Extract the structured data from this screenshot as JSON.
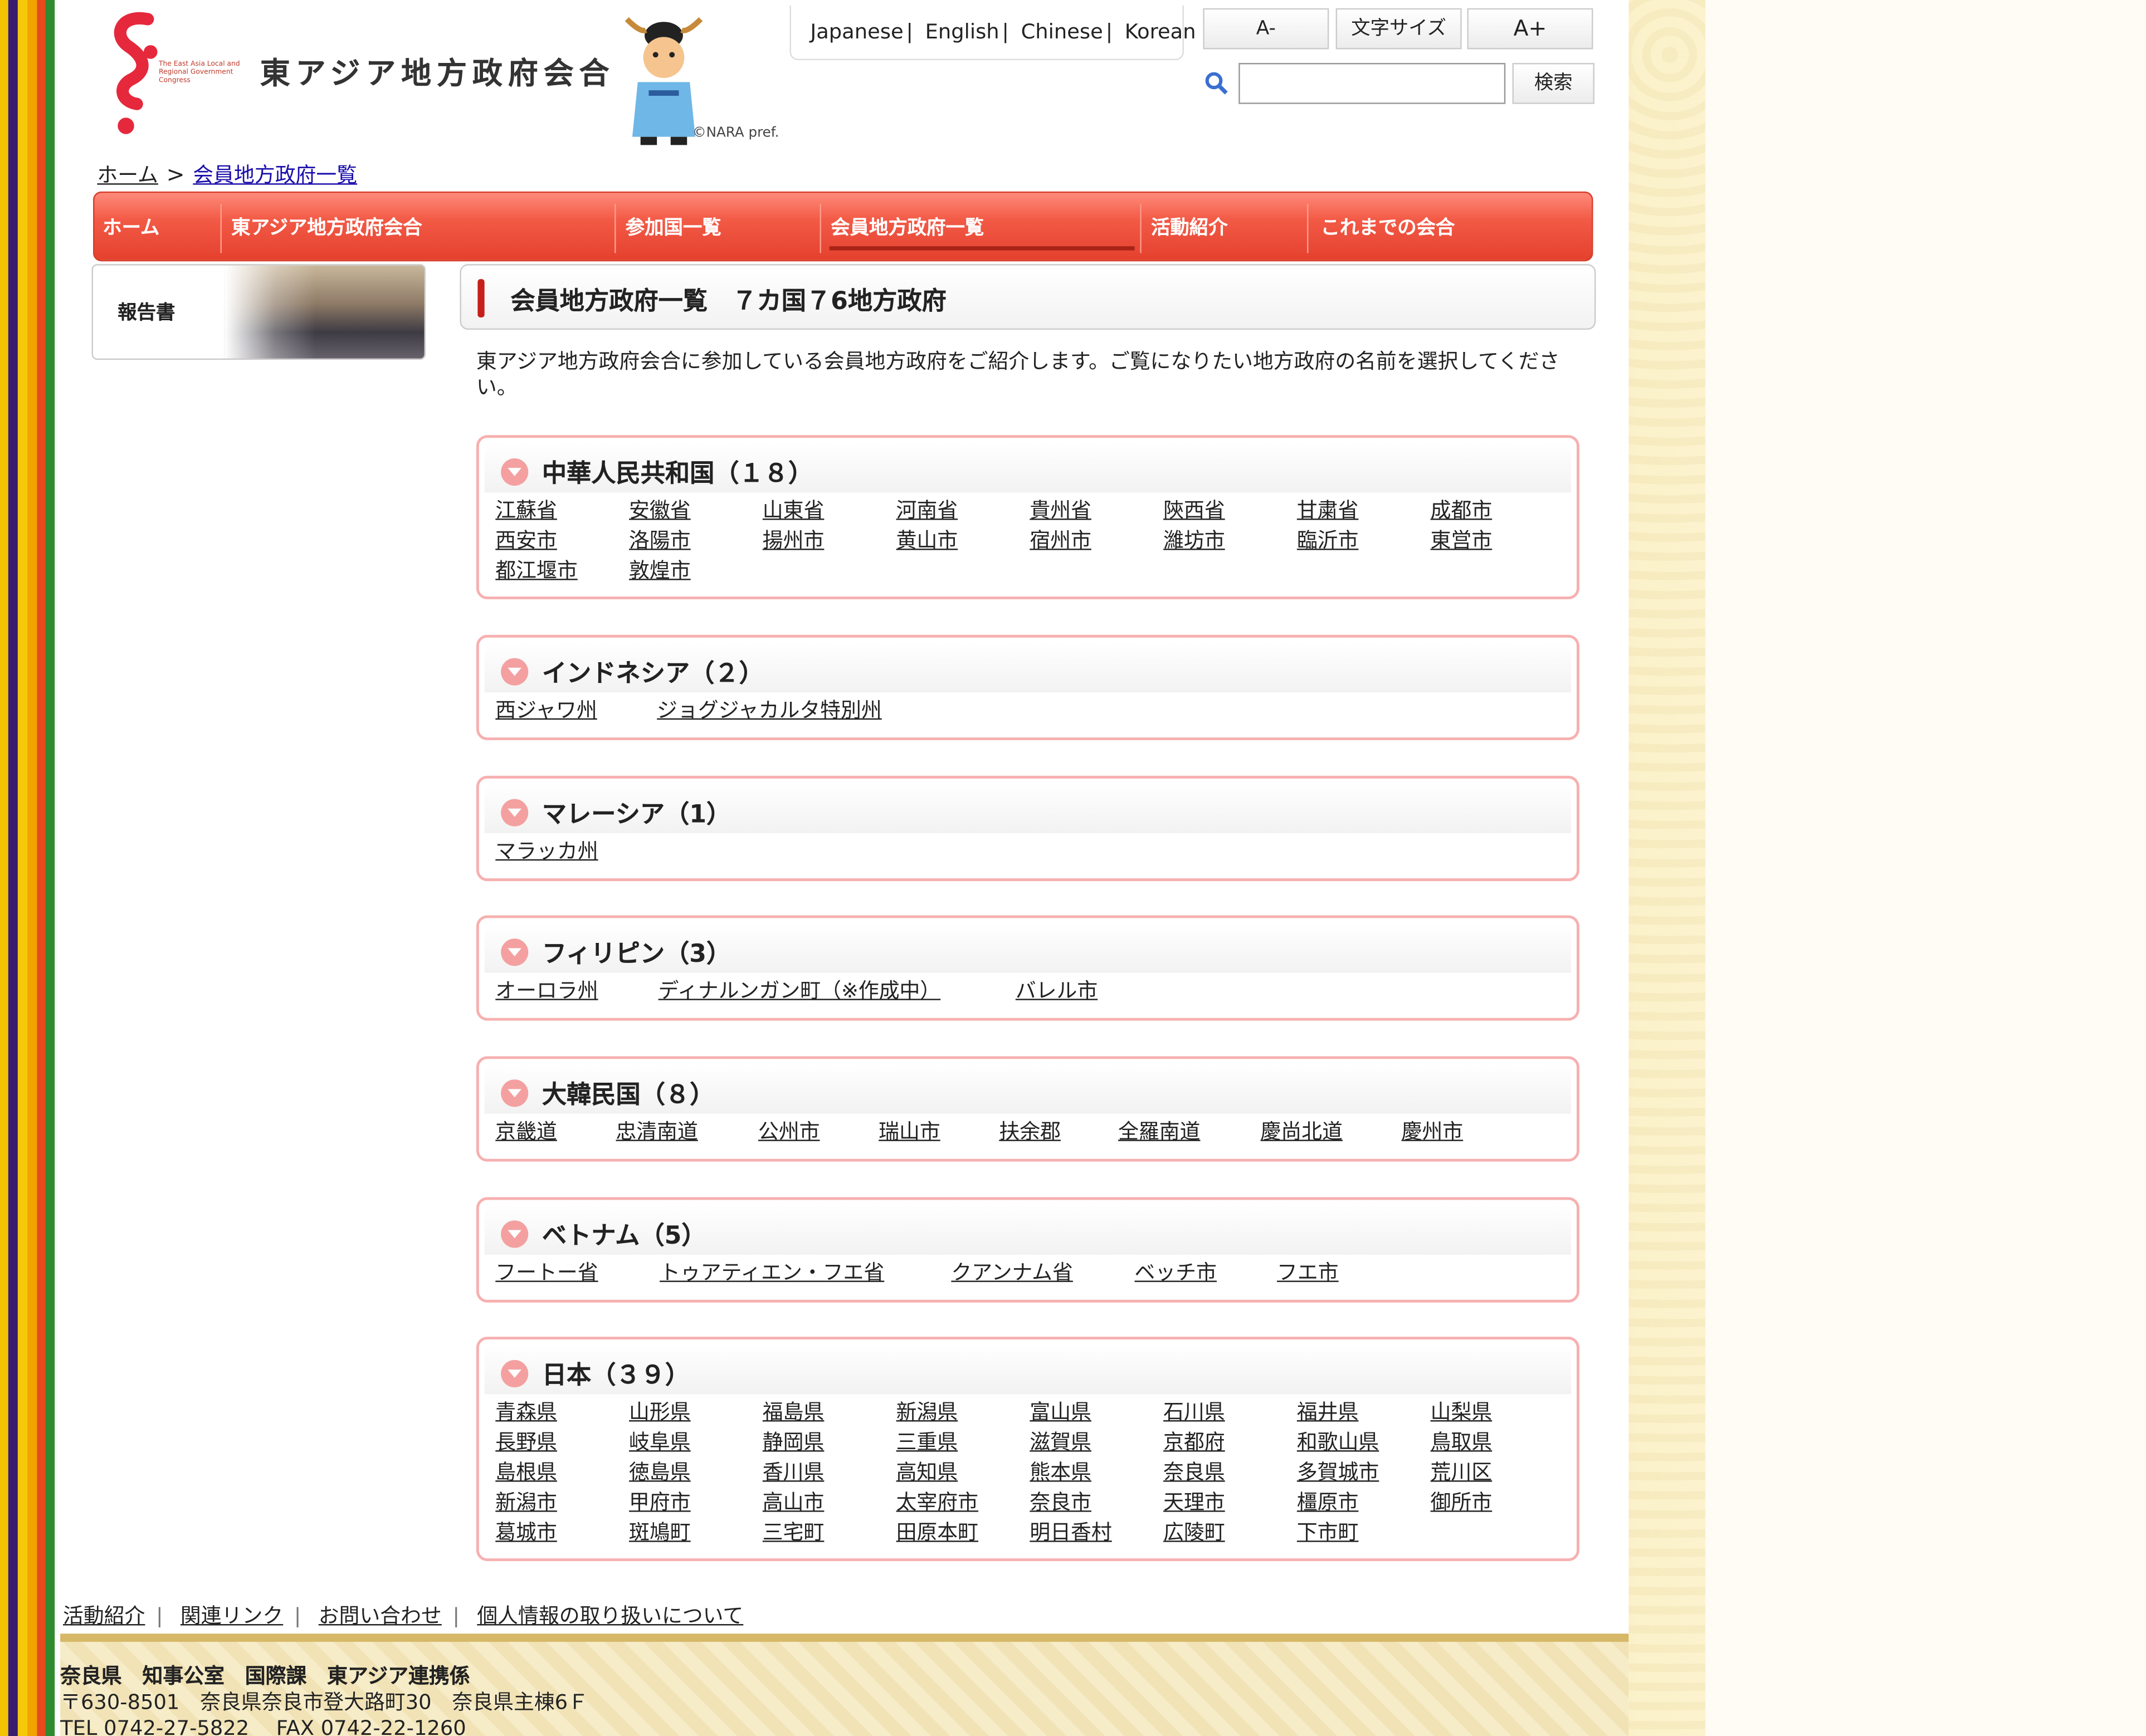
{
  "header": {
    "logo_text": "東アジア地方政府会合",
    "logo_sub": "The East Asia Local and Regional Government Congress",
    "credit": "©NARA pref.",
    "languages": [
      "Japanese",
      "English",
      "Chinese",
      "Korean"
    ],
    "font_small": "A-",
    "font_label": "文字サイズ",
    "font_large": "A+",
    "search_button": "検索",
    "search_value": ""
  },
  "breadcrumb": {
    "home": "ホーム",
    "sep": ">",
    "current": "会員地方政府一覧"
  },
  "nav": {
    "items": [
      "ホーム",
      "東アジア地方政府会合",
      "参加国一覧",
      "会員地方政府一覧",
      "活動紹介",
      "これまでの会合"
    ],
    "active": "会員地方政府一覧"
  },
  "sidebar": {
    "report_label": "報告書"
  },
  "main": {
    "title": "会員地方政府一覧　７カ国７6地方政府",
    "intro": "東アジア地方政府会合に参加している会員地方政府をご紹介します。ご覧になりたい地方政府の名前を選択してください。"
  },
  "countries": [
    {
      "name": "中華人民共和国（１８）",
      "links": [
        "江蘇省",
        "安徽省",
        "山東省",
        "河南省",
        "貴州省",
        "陝西省",
        "甘粛省",
        "成都市",
        "西安市",
        "洛陽市",
        "揚州市",
        "黄山市",
        "宿州市",
        "濰坊市",
        "臨沂市",
        "東営市",
        "都江堰市",
        "敦煌市"
      ]
    },
    {
      "name": "インドネシア（２）",
      "links": [
        "西ジャワ州",
        "ジョグジャカルタ特別州"
      ]
    },
    {
      "name": "マレーシア（1）",
      "links": [
        "マラッカ州"
      ]
    },
    {
      "name": "フィリピン（3）",
      "links": [
        "オーロラ州",
        "ディナルンガン町（※作成中）",
        "バレル市"
      ]
    },
    {
      "name": "大韓民国（８）",
      "links": [
        "京畿道",
        "忠清南道",
        "公州市",
        "瑞山市",
        "扶余郡",
        "全羅南道",
        "慶尚北道",
        "慶州市"
      ]
    },
    {
      "name": "ベトナム（5）",
      "links": [
        "フートー省",
        "トゥアティエン・フエ省",
        "クアンナム省",
        "ベッチ市",
        "フエ市"
      ]
    },
    {
      "name": "日本（３９）",
      "links": [
        "青森県",
        "山形県",
        "福島県",
        "新潟県",
        "富山県",
        "石川県",
        "福井県",
        "山梨県",
        "長野県",
        "岐阜県",
        "静岡県",
        "三重県",
        "滋賀県",
        "京都府",
        "和歌山県",
        "鳥取県",
        "島根県",
        "徳島県",
        "香川県",
        "高知県",
        "熊本県",
        "奈良県",
        "多賀城市",
        "荒川区",
        "新潟市",
        "甲府市",
        "高山市",
        "太宰府市",
        "奈良市",
        "天理市",
        "橿原市",
        "御所市",
        "葛城市",
        "斑鳩町",
        "三宅町",
        "田原本町",
        "明日香村",
        "広陵町",
        "下市町"
      ]
    }
  ],
  "footer": {
    "links": [
      "活動紹介",
      "関連リンク",
      "お問い合わせ",
      "個人情報の取り扱いについて"
    ],
    "org": "奈良県　知事公室　国際課　東アジア連携係",
    "address": "〒630-8501　奈良県奈良市登大路町30　奈良県主棟6Ｆ",
    "tel": "TEL 0742-27-5822　 FAX 0742-22-1260"
  },
  "colors": {
    "nav": "#e4412e",
    "accent": "#c6201a",
    "border_pink": "#f7b0b0",
    "footer_bg": "#f6ecc8"
  }
}
